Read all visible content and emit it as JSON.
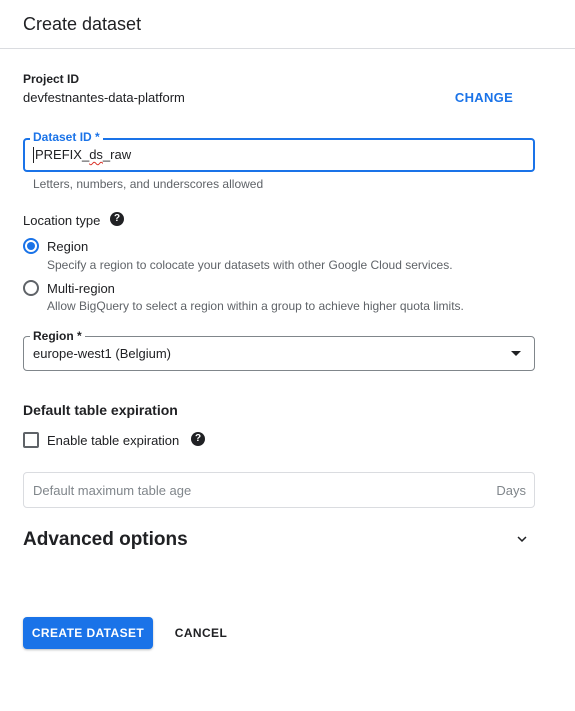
{
  "header": {
    "title": "Create dataset"
  },
  "project": {
    "label": "Project ID",
    "value": "devfestnantes-data-platform",
    "change_label": "CHANGE"
  },
  "dataset": {
    "label": "Dataset ID *",
    "value_prefix": "PREFIX_",
    "value_squiggle": "ds",
    "value_suffix": "_raw",
    "helper": "Letters, numbers, and underscores allowed"
  },
  "location": {
    "title": "Location type",
    "help_icon": "question-mark-icon",
    "selected": "region",
    "options": [
      {
        "id": "region",
        "label": "Region",
        "description": "Specify a region to colocate your datasets with other Google Cloud services."
      },
      {
        "id": "multi-region",
        "label": "Multi-region",
        "description": "Allow BigQuery to select a region within a group to achieve higher quota limits."
      }
    ]
  },
  "region": {
    "label": "Region *",
    "value": "europe-west1 (Belgium)"
  },
  "expiration": {
    "title": "Default table expiration",
    "checkbox_label": "Enable table expiration",
    "checked": false,
    "placeholder": "Default maximum table age",
    "suffix": "Days"
  },
  "advanced": {
    "title": "Advanced options",
    "icon": "chevron-down-icon"
  },
  "actions": {
    "create_label": "CREATE DATASET",
    "cancel_label": "CANCEL"
  },
  "colors": {
    "accent": "#1a73e8",
    "text": "#202124",
    "secondary_text": "#5f6368",
    "divider": "#dadce0",
    "error_underline": "#d93025"
  }
}
